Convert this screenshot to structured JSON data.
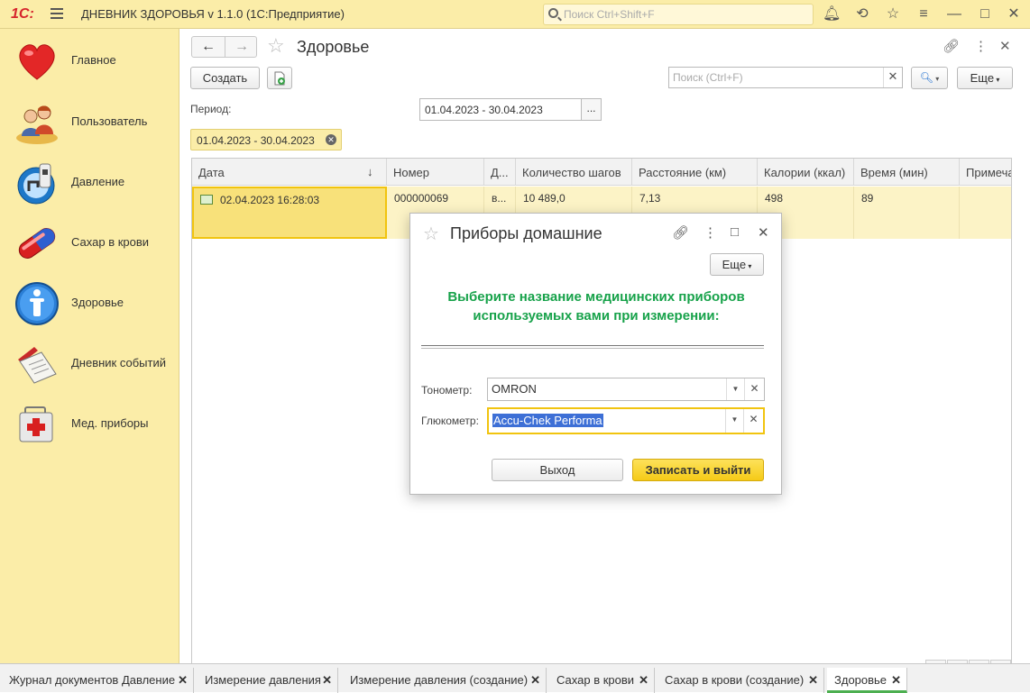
{
  "titlebar": {
    "logo": "1С:",
    "app_title": "ДНЕВНИК ЗДОРОВЬЯ v 1.1.0  (1С:Предприятие)",
    "search_placeholder": "Поиск Ctrl+Shift+F"
  },
  "sidebar": {
    "items": [
      {
        "label": "Главное",
        "icon": "heart-icon"
      },
      {
        "label": "Пользователь",
        "icon": "users-icon"
      },
      {
        "label": "Давление",
        "icon": "tonometer-icon"
      },
      {
        "label": "Сахар в крови",
        "icon": "pill-icon"
      },
      {
        "label": "Здоровье",
        "icon": "person-icon"
      },
      {
        "label": "Дневник событий",
        "icon": "journal-icon"
      },
      {
        "label": "Мед. приборы",
        "icon": "medkit-icon"
      }
    ]
  },
  "form": {
    "title": "Здоровье",
    "create_label": "Создать",
    "search_placeholder": "Поиск (Ctrl+F)",
    "more_label": "Еще",
    "period_label": "Период:",
    "period_value": "01.04.2023 - 30.04.2023",
    "period_chip": "01.04.2023 - 30.04.2023"
  },
  "table": {
    "columns": [
      "Дата",
      "Номер",
      "Д...",
      "Количество шагов",
      "Расстояние (км)",
      "Калории (ккал)",
      "Время (мин)",
      "Примеча..."
    ],
    "rows": [
      [
        "02.04.2023 16:28:03",
        "000000069",
        "в...",
        "10 489,0",
        "7,13",
        "498",
        "89",
        ""
      ]
    ]
  },
  "modal": {
    "title": "Приборы домашние",
    "more_label": "Еще",
    "message": "Выберите название  медицинских приборов используемых вами при измерении:",
    "tonometer_label": "Тонометр:",
    "tonometer_value": "OMRON",
    "glucometer_label": "Глюкометр:",
    "glucometer_value": "Accu-Chek Performa",
    "exit_label": "Выход",
    "save_label": "Записать и выйти"
  },
  "tabs": [
    {
      "label": "Журнал документов Давление"
    },
    {
      "label": "Измерение давления"
    },
    {
      "label": "Измерение давления (создание)"
    },
    {
      "label": "Сахар в крови"
    },
    {
      "label": "Сахар в крови (создание)"
    },
    {
      "label": "Здоровье",
      "active": true
    }
  ]
}
